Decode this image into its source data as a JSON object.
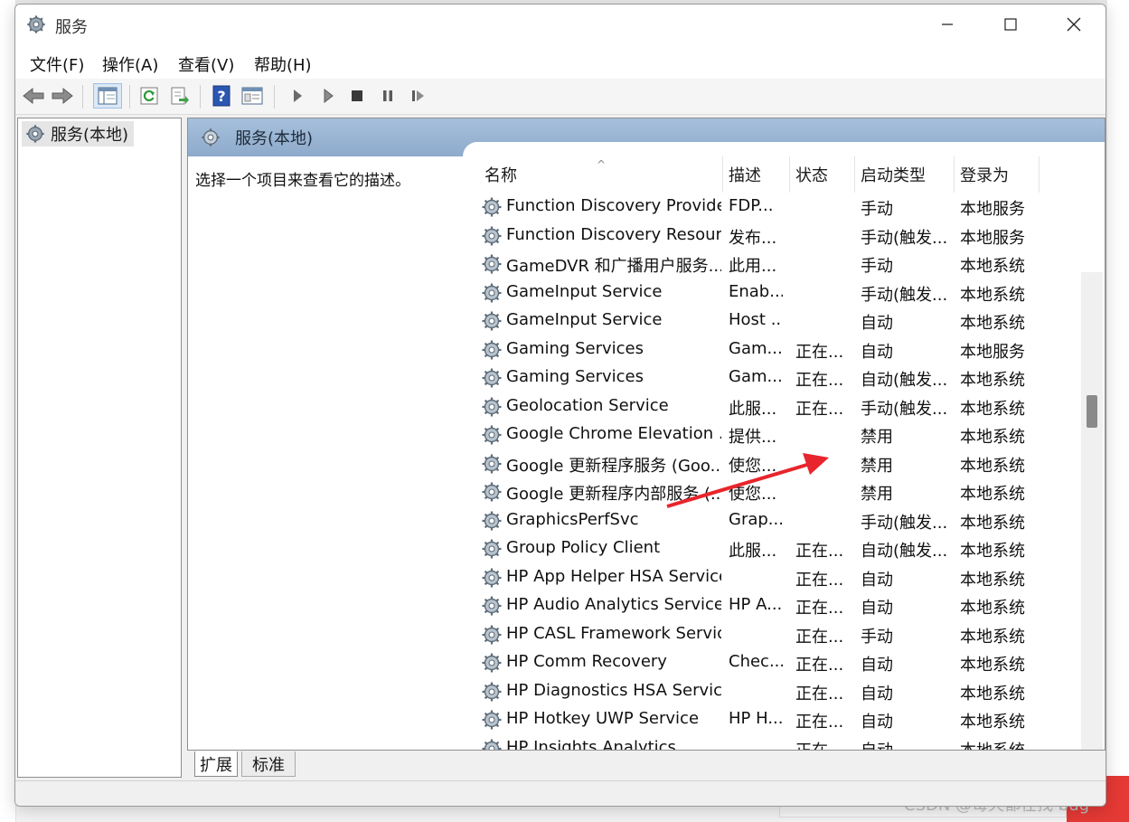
{
  "window": {
    "title": "服务"
  },
  "menubar": {
    "items": [
      "文件(F)",
      "操作(A)",
      "查看(V)",
      "帮助(H)"
    ]
  },
  "tree": {
    "root_label": "服务(本地)"
  },
  "main": {
    "header_title": "服务(本地)",
    "description_prompt": "选择一个项目来查看它的描述。"
  },
  "table": {
    "columns": [
      "名称",
      "描述",
      "状态",
      "启动类型",
      "登录为"
    ],
    "rows": [
      {
        "name": "Function Discovery Provide...",
        "desc": "FDP...",
        "status": "",
        "startup": "手动",
        "logon": "本地服务"
      },
      {
        "name": "Function Discovery Resour...",
        "desc": "发布...",
        "status": "",
        "startup": "手动(触发...",
        "logon": "本地服务"
      },
      {
        "name": "GameDVR 和广播用户服务...",
        "desc": "此用...",
        "status": "",
        "startup": "手动",
        "logon": "本地系统"
      },
      {
        "name": "GameInput Service",
        "desc": "Enab...",
        "status": "",
        "startup": "手动(触发...",
        "logon": "本地系统"
      },
      {
        "name": "GameInput Service",
        "desc": "Host ...",
        "status": "",
        "startup": "自动",
        "logon": "本地系统"
      },
      {
        "name": "Gaming Services",
        "desc": "Gam...",
        "status": "正在...",
        "startup": "自动",
        "logon": "本地服务"
      },
      {
        "name": "Gaming Services",
        "desc": "Gam...",
        "status": "正在...",
        "startup": "自动(触发...",
        "logon": "本地系统"
      },
      {
        "name": "Geolocation Service",
        "desc": "此服...",
        "status": "正在...",
        "startup": "手动(触发...",
        "logon": "本地系统"
      },
      {
        "name": "Google Chrome Elevation ...",
        "desc": "提供...",
        "status": "",
        "startup": "禁用",
        "logon": "本地系统"
      },
      {
        "name": "Google 更新程序服务 (Goo...",
        "desc": "使您...",
        "status": "",
        "startup": "禁用",
        "logon": "本地系统"
      },
      {
        "name": "Google 更新程序内部服务 (...",
        "desc": "使您...",
        "status": "",
        "startup": "禁用",
        "logon": "本地系统"
      },
      {
        "name": "GraphicsPerfSvc",
        "desc": "Grap...",
        "status": "",
        "startup": "手动(触发...",
        "logon": "本地系统"
      },
      {
        "name": "Group Policy Client",
        "desc": "此服...",
        "status": "正在...",
        "startup": "自动(触发...",
        "logon": "本地系统"
      },
      {
        "name": "HP App Helper HSA Service",
        "desc": "",
        "status": "正在...",
        "startup": "自动",
        "logon": "本地系统"
      },
      {
        "name": "HP Audio Analytics Service",
        "desc": "HP A...",
        "status": "正在...",
        "startup": "自动",
        "logon": "本地系统"
      },
      {
        "name": "HP CASL Framework Service",
        "desc": "",
        "status": "正在...",
        "startup": "手动",
        "logon": "本地系统"
      },
      {
        "name": "HP Comm Recovery",
        "desc": "Chec...",
        "status": "正在...",
        "startup": "自动",
        "logon": "本地系统"
      },
      {
        "name": "HP Diagnostics HSA Service",
        "desc": "",
        "status": "正在...",
        "startup": "自动",
        "logon": "本地系统"
      },
      {
        "name": "HP Hotkey UWP Service",
        "desc": "HP H...",
        "status": "正在...",
        "startup": "自动",
        "logon": "本地系统"
      },
      {
        "name": "HP Insights Analytics",
        "desc": "",
        "status": "正在...",
        "startup": "自动",
        "logon": "本地系统"
      }
    ]
  },
  "tabs": {
    "extended": "扩展",
    "standard": "标准"
  },
  "watermark": "CSDN @每天都在找 bug",
  "colors": {
    "header_blue": "#8eaacb",
    "arrow_red": "#e8252c"
  }
}
